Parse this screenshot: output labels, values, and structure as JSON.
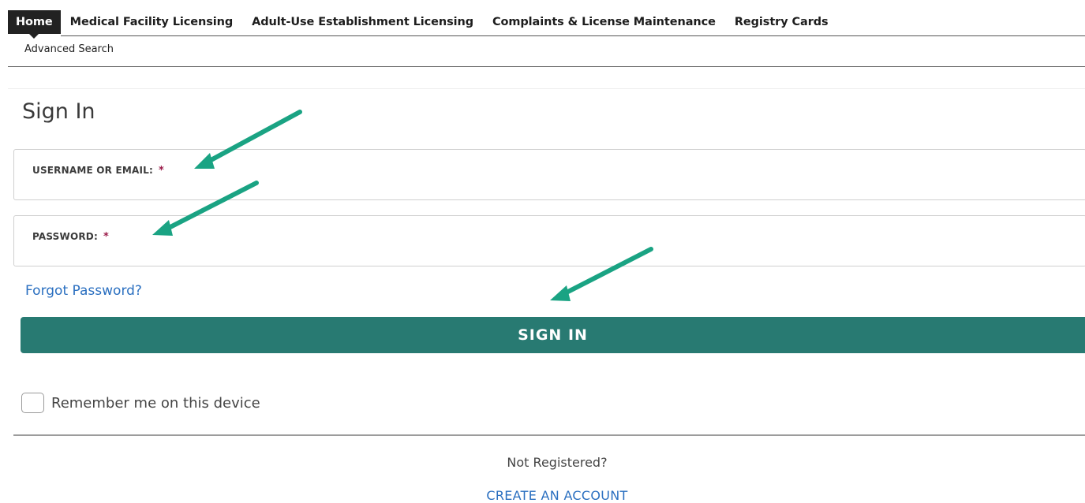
{
  "nav": {
    "items": [
      {
        "label": "Home",
        "active": true
      },
      {
        "label": "Medical Facility Licensing",
        "active": false
      },
      {
        "label": "Adult-Use Establishment Licensing",
        "active": false
      },
      {
        "label": "Complaints & License Maintenance",
        "active": false
      },
      {
        "label": "Registry Cards",
        "active": false
      }
    ],
    "sub_items": [
      "Advanced Search"
    ]
  },
  "signin": {
    "title": "Sign In",
    "username_label": "USERNAME OR EMAIL:",
    "username_value": "",
    "password_label": "PASSWORD:",
    "password_value": "",
    "required_marker": "*",
    "forgot_link": "Forgot Password?",
    "submit_label": "SIGN IN",
    "remember_label": "Remember me on this device",
    "remember_checked": false
  },
  "footer": {
    "not_registered": "Not Registered?",
    "create_account": "CREATE AN ACCOUNT"
  },
  "colors": {
    "primary_button": "#287a72",
    "link": "#2a6fc0",
    "required": "#9b1c4a",
    "annotation_arrow": "#1aa383",
    "nav_active_bg": "#222222"
  },
  "annotations": {
    "arrow_icon": "arrow-annotation-icon",
    "count": 3
  }
}
